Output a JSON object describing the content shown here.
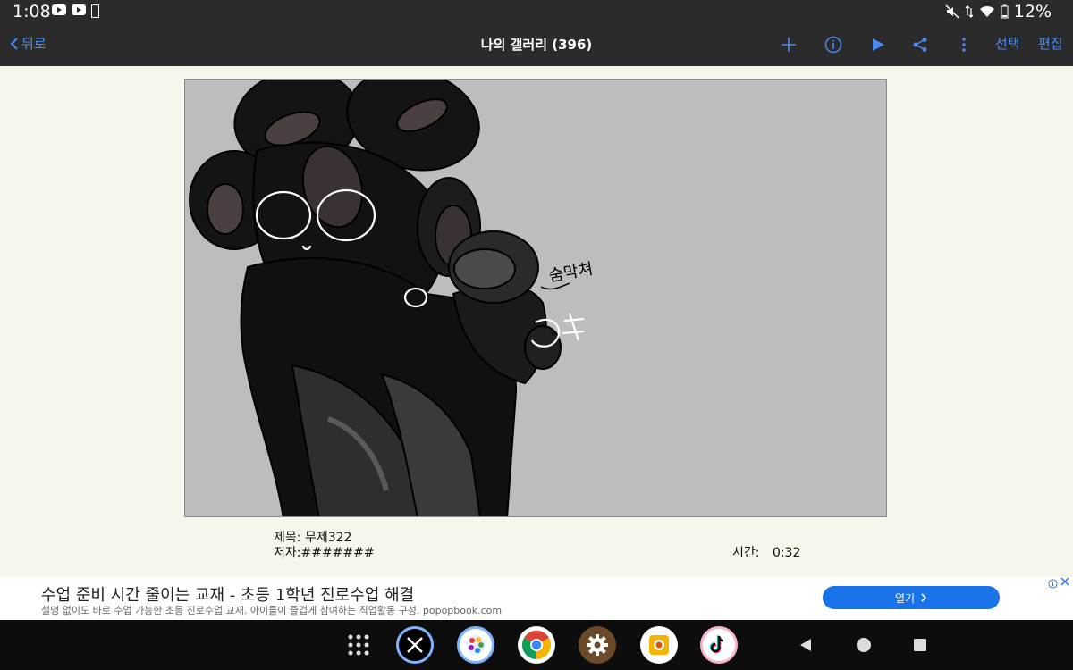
{
  "status_bar": {
    "time": "1:08",
    "battery": "12%"
  },
  "app_bar": {
    "back_label": "뒤로",
    "title": "나의 갤러리 (396)",
    "select_label": "선택",
    "edit_label": "편집",
    "accent": "#4b8bf0"
  },
  "artwork": {
    "handwriting": "숨막쳐",
    "background_color": "#bdbdbd"
  },
  "meta": {
    "title_label": "제목:",
    "title_value": "무제322",
    "author_label": "저자:",
    "author_value": "#######",
    "time_label": "시간:",
    "time_value": "0:32"
  },
  "ad": {
    "title": "수업 준비 시간 줄이는 교재 - 초등 1학년 진로수업 해결",
    "description": "설명 없이도 바로 수업 가능한 초등 진로수업 교재. 아이들이 즐겁게 참여하는 직업활동 구성. popopbook.com",
    "button_label": "열기",
    "button_color": "#1a73e8"
  },
  "dock": {
    "apps": [
      "app-drawer-icon",
      "x-app-icon",
      "ibis-paint-icon",
      "chrome-icon",
      "settings-icon",
      "camera-app-icon",
      "tiktok-icon"
    ]
  }
}
